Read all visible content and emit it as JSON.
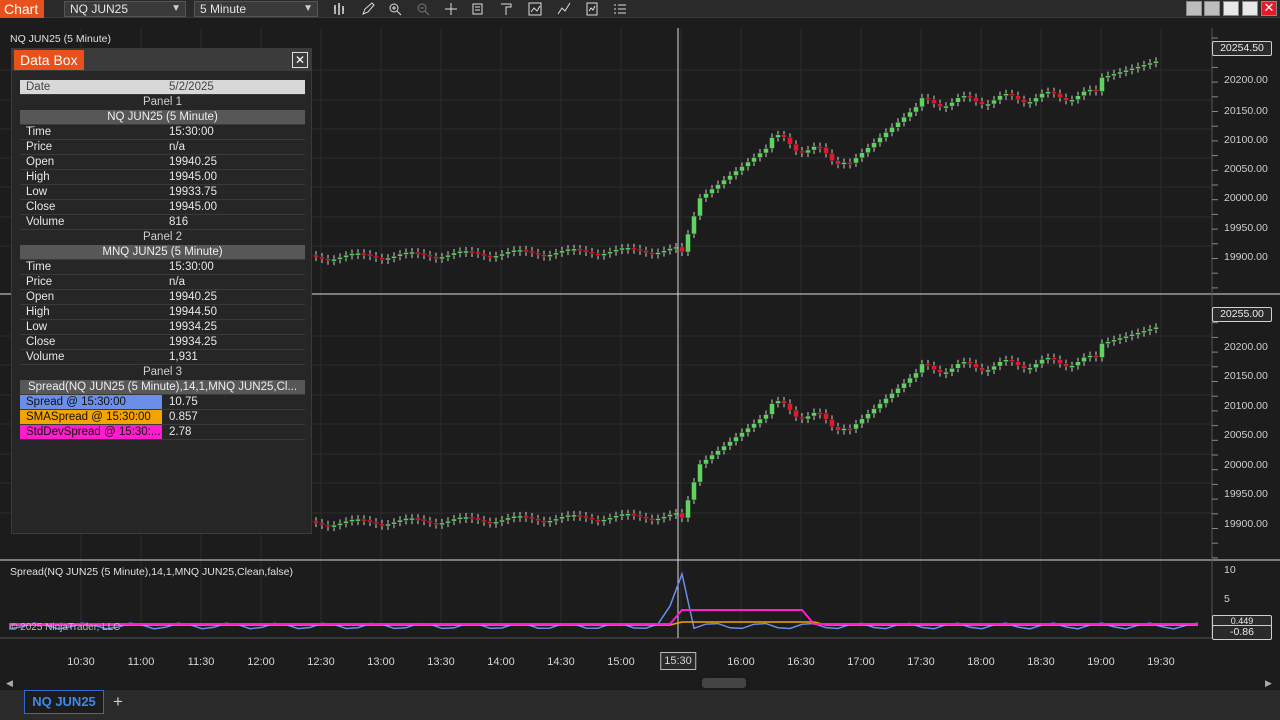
{
  "toolbar": {
    "chart_label": "Chart",
    "instrument": "NQ JUN25",
    "interval": "5 Minute",
    "icons": [
      "bar-style-icon",
      "drawing-pencil-icon",
      "zoom-in-icon",
      "zoom-out-icon",
      "crosshair-icon",
      "properties-icon",
      "templates-icon",
      "strategies-icon",
      "indicators-icon",
      "data-series-icon",
      "more-menu-icon"
    ]
  },
  "panels": {
    "panel1_title": "NQ JUN25 (5 Minute)",
    "panel3_title": "Spread(NQ JUN25 (5 Minute),14,1,MNQ JUN25,Clean,false)",
    "panel1_price_tag": "20254.50",
    "panel2_price_tag": "20255.00",
    "panel3_tag_1": "0.449",
    "panel3_tag_2": "-0.86",
    "panel1_axis": [
      "20200.00",
      "20150.00",
      "20100.00",
      "20050.00",
      "20000.00",
      "19950.00",
      "19900.00"
    ],
    "panel2_axis": [
      "20200.00",
      "20150.00",
      "20100.00",
      "20050.00",
      "20000.00",
      "19950.00",
      "19900.00"
    ],
    "panel3_axis": [
      "10",
      "5"
    ],
    "copyright": "© 2025 NinjaTrader, LLC"
  },
  "time_axis": [
    "10:30",
    "11:00",
    "11:30",
    "12:00",
    "12:30",
    "13:00",
    "13:30",
    "14:00",
    "14:30",
    "15:00",
    "15:30",
    "16:00",
    "16:30",
    "17:00",
    "17:30",
    "18:00",
    "18:30",
    "19:00",
    "19:30"
  ],
  "cursor_time": "15:30",
  "tabs": {
    "main": "NQ JUN25",
    "add": "+"
  },
  "databox": {
    "title": "Data Box",
    "date_label": "Date",
    "date_value": "5/2/2025",
    "panel1": "Panel 1",
    "series1": "NQ JUN25 (5 Minute)",
    "s1": [
      {
        "k": "Time",
        "v": "15:30:00"
      },
      {
        "k": "Price",
        "v": "n/a"
      },
      {
        "k": "Open",
        "v": "19940.25"
      },
      {
        "k": "High",
        "v": "19945.00"
      },
      {
        "k": "Low",
        "v": "19933.75"
      },
      {
        "k": "Close",
        "v": "19945.00"
      },
      {
        "k": "Volume",
        "v": "816"
      }
    ],
    "panel2": "Panel 2",
    "series2": "MNQ JUN25 (5 Minute)",
    "s2": [
      {
        "k": "Time",
        "v": "15:30:00"
      },
      {
        "k": "Price",
        "v": "n/a"
      },
      {
        "k": "Open",
        "v": "19940.25"
      },
      {
        "k": "High",
        "v": "19944.50"
      },
      {
        "k": "Low",
        "v": "19934.25"
      },
      {
        "k": "Close",
        "v": "19934.25"
      },
      {
        "k": "Volume",
        "v": "1,931"
      }
    ],
    "panel3": "Panel 3",
    "series3": "Spread(NQ JUN25 (5 Minute),14,1,MNQ JUN25,Cl...",
    "s3": [
      {
        "k": "Spread @ 15:30:00",
        "v": "10.75",
        "color": "#6b8fe8"
      },
      {
        "k": "SMASpread @ 15:30:00",
        "v": "0.857",
        "color": "#f5a300"
      },
      {
        "k": "StdDevSpread @ 15:30:...",
        "v": "2.78",
        "color": "#ff1ccc"
      }
    ]
  },
  "colors": {
    "up": "#5fd35f",
    "down": "#e3162a",
    "spread": "#6b8fe8",
    "sma": "#f5a300",
    "stddev": "#ff1ccc",
    "accent": "#e8501c"
  }
}
